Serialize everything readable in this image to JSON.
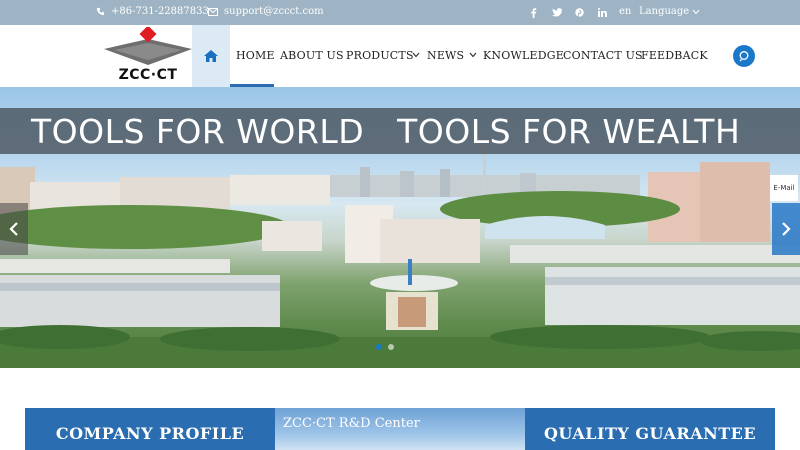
{
  "topbar": {
    "phone": "+86-731-22887833",
    "email": "support@zccct.com",
    "social": [
      "facebook-icon",
      "twitter-icon",
      "pinterest-icon",
      "linkedin-icon"
    ],
    "lang_code": "en",
    "language_label": "Language"
  },
  "logo": {
    "text": "ZCC·CT"
  },
  "nav": {
    "items": [
      "HOME",
      "ABOUT US",
      "PRODUCTS",
      "NEWS",
      "KNOWLEDGE",
      "CONTACT US",
      "FEEDBACK"
    ],
    "active": "HOME"
  },
  "banner": {
    "slogan": "TOOLS FOR WORLD   TOOLS FOR WEALTH",
    "email_tab": "E-Mail",
    "slide_count": 2,
    "active_slide": 1
  },
  "cards": {
    "left": "COMPANY PROFILE",
    "middle_caption": "ZCC·CT R&D Center",
    "right": "QUALITY GUARANTEE"
  },
  "colors": {
    "accent": "#2a6db0",
    "topbar_bg": "#9eb4c4",
    "search_bg": "#1a78c8"
  }
}
